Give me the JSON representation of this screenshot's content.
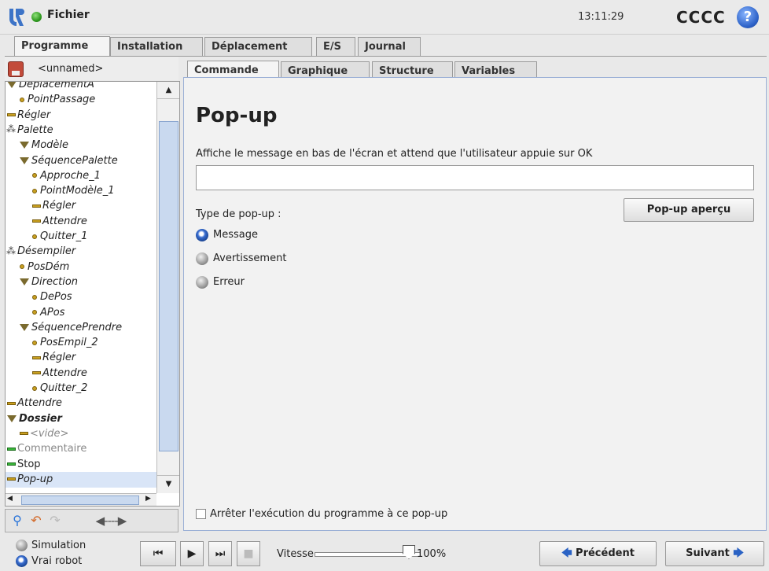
{
  "header": {
    "menu": "Fichier",
    "clock": "13:11:29",
    "robot_name": "CCCC",
    "help_symbol": "?"
  },
  "main_tabs": [
    {
      "label": "Programme",
      "active": true
    },
    {
      "label": "Installation",
      "active": false
    },
    {
      "label": "Déplacement",
      "active": false
    },
    {
      "label": "E/S",
      "active": false
    },
    {
      "label": "Journal",
      "active": false
    }
  ],
  "program": {
    "name": "<unnamed>"
  },
  "tree": [
    {
      "label": "DéplacementA",
      "icon": "tri",
      "indent": 0
    },
    {
      "label": "PointPassage",
      "icon": "dot",
      "indent": 1
    },
    {
      "label": "Régler",
      "icon": "bar",
      "indent": 0
    },
    {
      "label": "Palette",
      "icon": "conn",
      "indent": 0
    },
    {
      "label": "Modèle",
      "icon": "tri",
      "indent": 1
    },
    {
      "label": "SéquencePalette",
      "icon": "tri",
      "indent": 1
    },
    {
      "label": "Approche_1",
      "icon": "dot",
      "indent": 2
    },
    {
      "label": "PointModèle_1",
      "icon": "dot",
      "indent": 2
    },
    {
      "label": "Régler",
      "icon": "bar",
      "indent": 2
    },
    {
      "label": "Attendre",
      "icon": "bar",
      "indent": 2
    },
    {
      "label": "Quitter_1",
      "icon": "dot",
      "indent": 2
    },
    {
      "label": "Désempiler",
      "icon": "conn",
      "indent": 0
    },
    {
      "label": "PosDém",
      "icon": "dot",
      "indent": 1
    },
    {
      "label": "Direction",
      "icon": "tri",
      "indent": 1
    },
    {
      "label": "DePos",
      "icon": "dot",
      "indent": 2
    },
    {
      "label": "APos",
      "icon": "dot",
      "indent": 2
    },
    {
      "label": "SéquencePrendre",
      "icon": "tri",
      "indent": 1
    },
    {
      "label": "PosEmpil_2",
      "icon": "dot",
      "indent": 2
    },
    {
      "label": "Régler",
      "icon": "bar",
      "indent": 2
    },
    {
      "label": "Attendre",
      "icon": "bar",
      "indent": 2
    },
    {
      "label": "Quitter_2",
      "icon": "dot",
      "indent": 2
    },
    {
      "label": "Attendre",
      "icon": "bar",
      "indent": 0
    },
    {
      "label": "Dossier",
      "icon": "tri",
      "indent": 0,
      "style": "bold"
    },
    {
      "label": "<vide>",
      "icon": "bar",
      "indent": 1,
      "style": "gray"
    },
    {
      "label": "Commentaire",
      "icon": "bar-green",
      "indent": 0,
      "style": "normal-gray"
    },
    {
      "label": "Stop",
      "icon": "bar-green",
      "indent": 0,
      "style": "normal"
    },
    {
      "label": "Pop-up",
      "icon": "bar",
      "indent": 0,
      "style": "selected"
    }
  ],
  "content_tabs": [
    {
      "label": "Commande",
      "active": true
    },
    {
      "label": "Graphique",
      "active": false
    },
    {
      "label": "Structure",
      "active": false
    },
    {
      "label": "Variables",
      "active": false
    }
  ],
  "popup": {
    "title": "Pop-up",
    "description": "Affiche le message en bas de l'écran et attend que l'utilisateur appuie sur OK",
    "message_value": "",
    "preview_button": "Pop-up aperçu",
    "type_label": "Type de pop-up :",
    "types": [
      {
        "label": "Message",
        "selected": true
      },
      {
        "label": "Avertissement",
        "selected": false
      },
      {
        "label": "Erreur",
        "selected": false
      }
    ],
    "stop_checkbox": "Arrêter l'exécution du programme à ce pop-up",
    "stop_checked": false
  },
  "bottom": {
    "modes": [
      {
        "label": "Simulation",
        "selected": false
      },
      {
        "label": "Vrai robot",
        "selected": true
      }
    ],
    "speed_label": "Vitesse",
    "speed_value": "100%",
    "speed_fraction": 1.0,
    "prev_button": "Précédent",
    "next_button": "Suivant"
  }
}
